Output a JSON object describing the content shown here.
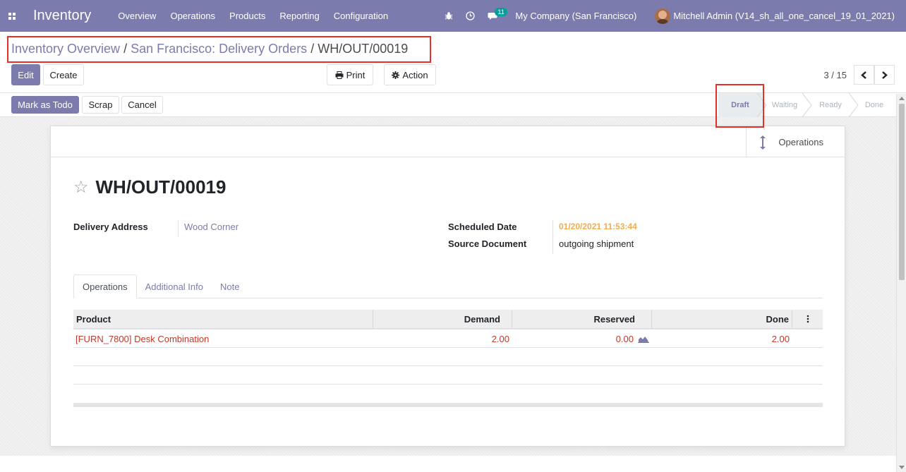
{
  "navbar": {
    "app_name": "Inventory",
    "menu": [
      "Overview",
      "Operations",
      "Products",
      "Reporting",
      "Configuration"
    ],
    "chat_count": "11",
    "company": "My Company (San Francisco)",
    "user": "Mitchell Admin (V14_sh_all_one_cancel_19_01_2021)"
  },
  "breadcrumb": {
    "items": [
      "Inventory Overview",
      "San Francisco: Delivery Orders"
    ],
    "separator": "/",
    "current": "WH/OUT/00019"
  },
  "toolbar": {
    "edit_label": "Edit",
    "create_label": "Create",
    "print_label": "Print",
    "action_label": "Action"
  },
  "pager": {
    "value": "3 / 15"
  },
  "actions": {
    "mark_todo_label": "Mark as Todo",
    "scrap_label": "Scrap",
    "cancel_label": "Cancel"
  },
  "status": {
    "steps": [
      "Draft",
      "Waiting",
      "Ready",
      "Done"
    ],
    "active": "Draft"
  },
  "smart_button": {
    "label": "Operations"
  },
  "record": {
    "name": "WH/OUT/00019",
    "delivery_address_label": "Delivery Address",
    "delivery_address": "Wood Corner",
    "scheduled_date_label": "Scheduled Date",
    "scheduled_date": "01/20/2021 11:53:44",
    "source_document_label": "Source Document",
    "source_document": "outgoing shipment"
  },
  "tabs": [
    "Operations",
    "Additional Info",
    "Note"
  ],
  "table": {
    "headers": {
      "product": "Product",
      "demand": "Demand",
      "reserved": "Reserved",
      "done": "Done"
    },
    "rows": [
      {
        "product": "[FURN_7800] Desk Combination",
        "demand": "2.00",
        "reserved": "0.00",
        "done": "2.00"
      }
    ]
  },
  "colors": {
    "brand": "#7c7bad",
    "highlight_box": "#e2302a",
    "scheduled_date": "#f0ad4e",
    "row_text": "#c0392b"
  }
}
